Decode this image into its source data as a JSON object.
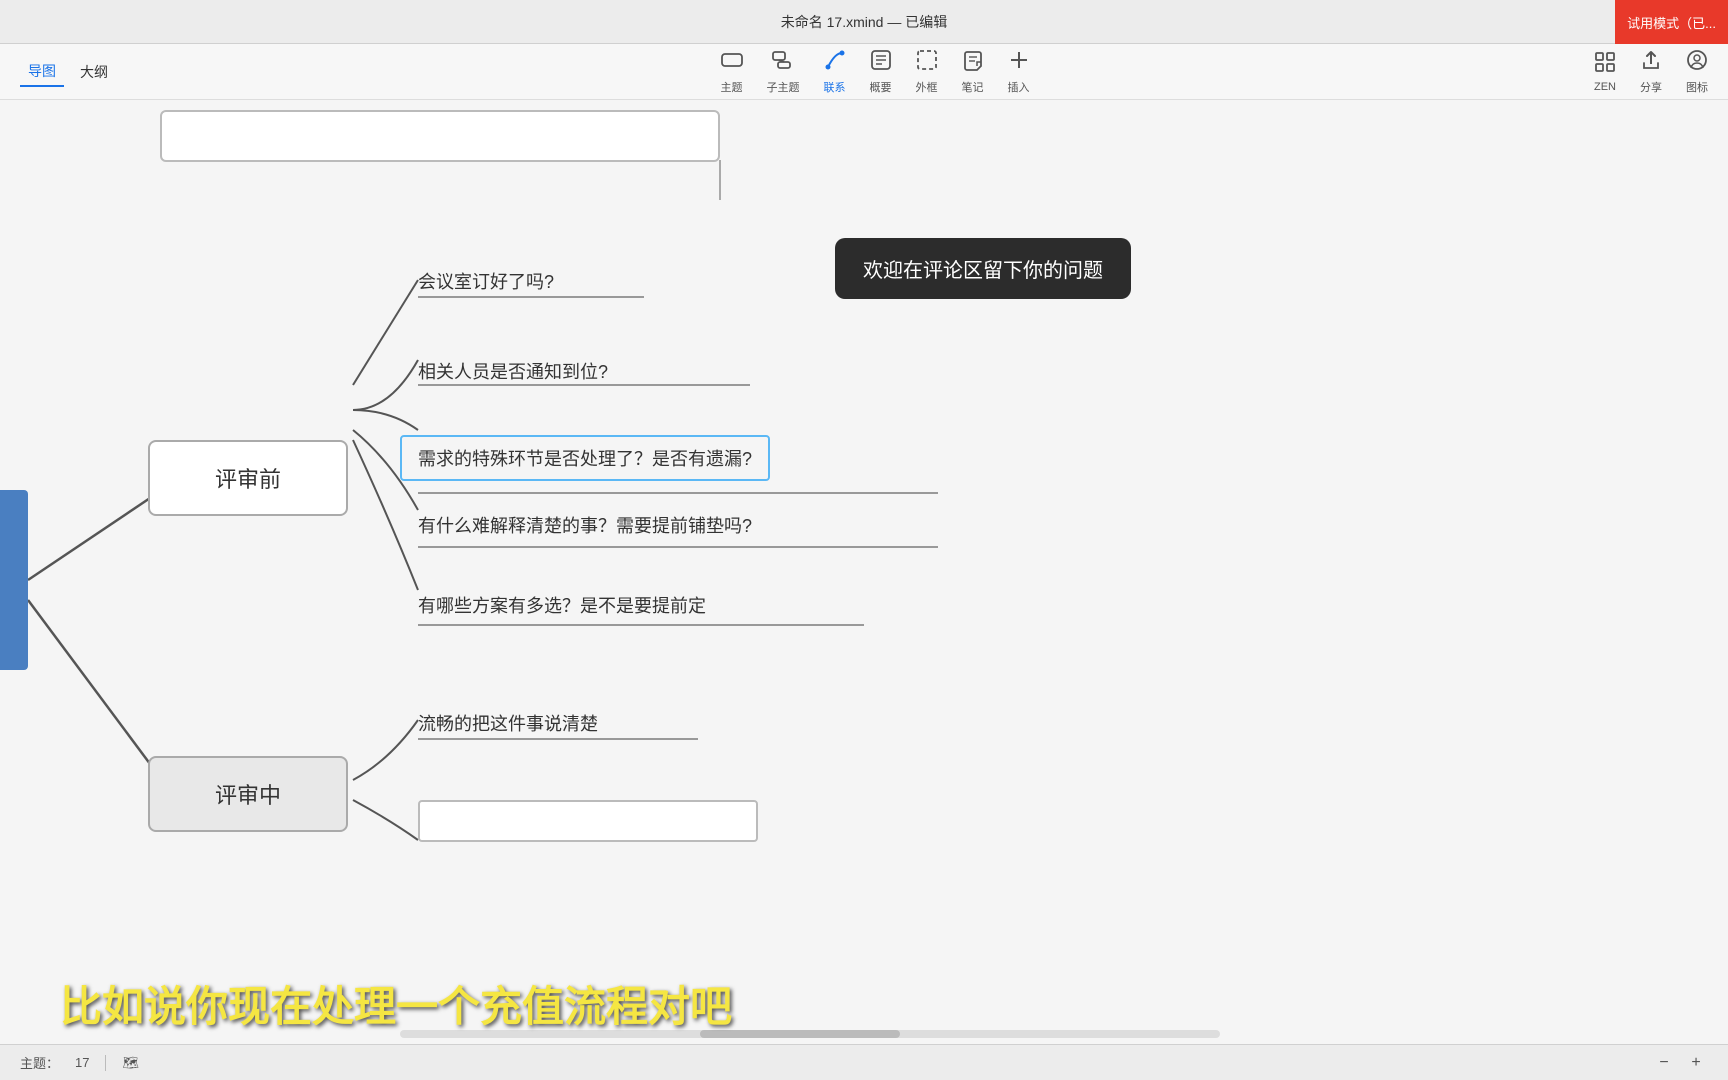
{
  "titleBar": {
    "title": "未命名 17.xmind — 已编辑",
    "trialBadge": "试用模式（已..."
  },
  "toolbar": {
    "leftItems": [
      {
        "label": "导图",
        "active": true
      },
      {
        "label": "大纲",
        "active": false
      }
    ],
    "centerItems": [
      {
        "icon": "⊞",
        "label": "主题",
        "active": false
      },
      {
        "icon": "⊡",
        "label": "子主题",
        "active": false
      },
      {
        "icon": "↩",
        "label": "联系",
        "active": true
      },
      {
        "icon": "⊟",
        "label": "概要",
        "active": false
      },
      {
        "icon": "⬚",
        "label": "外框",
        "active": false
      },
      {
        "icon": "✎",
        "label": "笔记",
        "active": false
      },
      {
        "icon": "+",
        "label": "插入",
        "active": false
      }
    ],
    "rightItems": [
      {
        "icon": "⛶",
        "label": "ZEN"
      },
      {
        "icon": "↑",
        "label": "分享"
      },
      {
        "icon": "☺",
        "label": "图标"
      }
    ]
  },
  "mindmap": {
    "topPartialText": "",
    "tooltip": "欢迎在评论区留下你的问题",
    "meetingLabel": "会议室订好了吗?",
    "node1": {
      "label": "评审前",
      "subtopics": [
        "相关人员是否通知到位?",
        "需求的特殊环节是否处理了？是否有遗漏?",
        "有什么难解释清楚的事？需要提前铺垫吗?",
        "有哪些方案有多选？是不是要提前定"
      ],
      "selectedIndex": 1
    },
    "node2": {
      "label": "评审中",
      "subtopics": [
        "流畅的把这件事说清楚",
        ""
      ]
    }
  },
  "caption": {
    "text": "比如说你现在处理一个充值流程对吧"
  },
  "statusBar": {
    "topicsLabel": "主题：",
    "topicsCount": "17",
    "mapIcon": "🗺",
    "zoomMinus": "−",
    "zoomPlus": "+"
  }
}
